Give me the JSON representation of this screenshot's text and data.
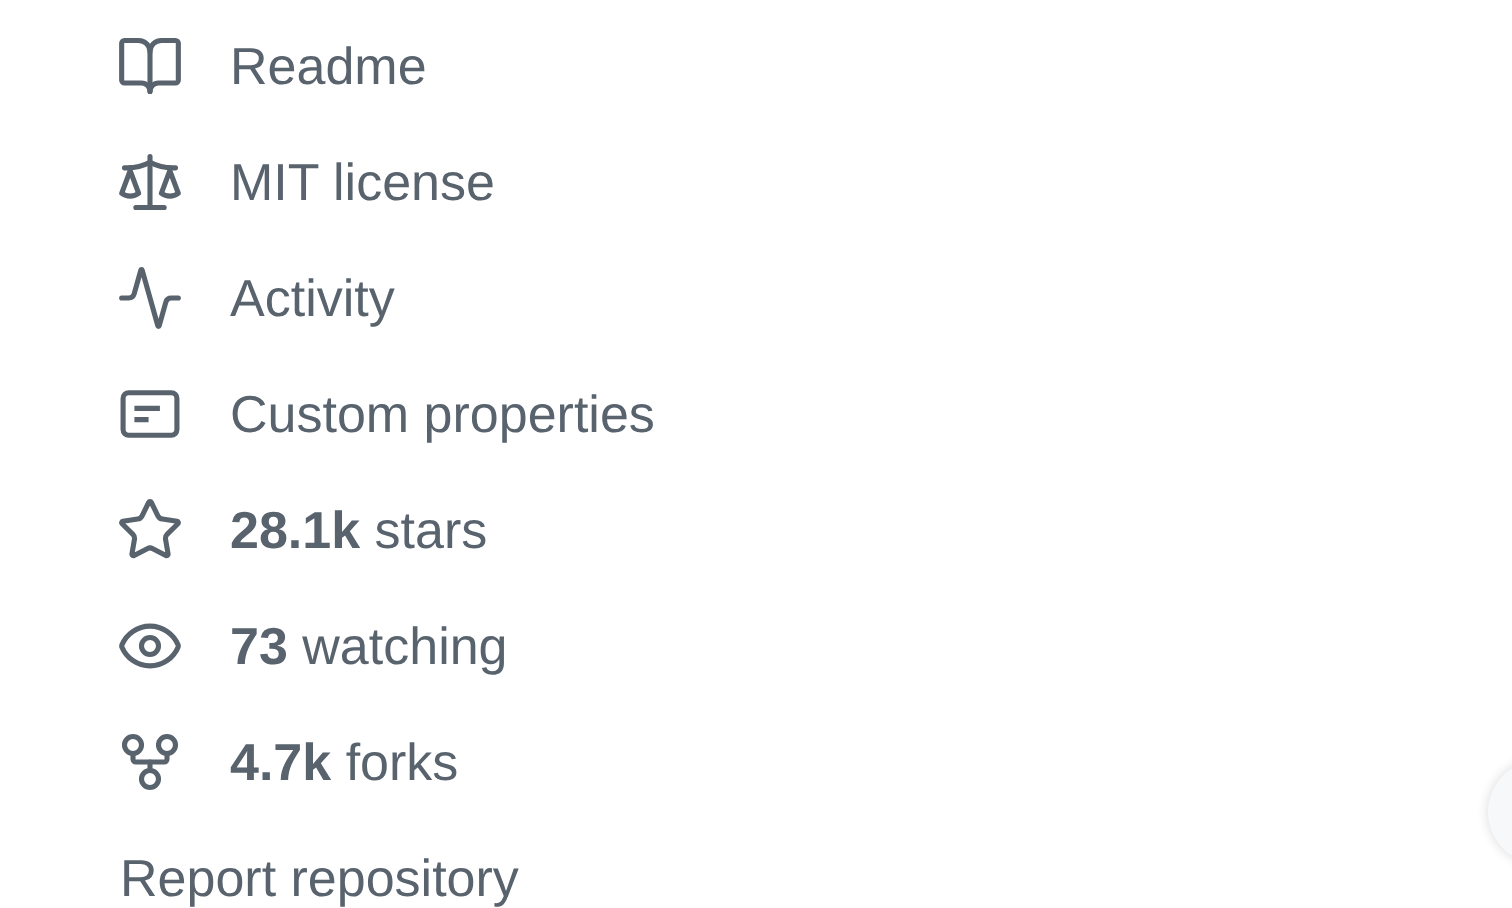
{
  "items": [
    {
      "kind": "readme",
      "label": "Readme"
    },
    {
      "kind": "license",
      "label": "MIT license"
    },
    {
      "kind": "activity",
      "label": "Activity"
    },
    {
      "kind": "properties",
      "label": "Custom properties"
    },
    {
      "kind": "stars",
      "label": "**28.1k** stars"
    },
    {
      "kind": "watching",
      "label": "**73** watching"
    },
    {
      "kind": "forks",
      "label": "**4.7k** forks"
    },
    {
      "kind": "report",
      "label": "Report repository"
    }
  ]
}
